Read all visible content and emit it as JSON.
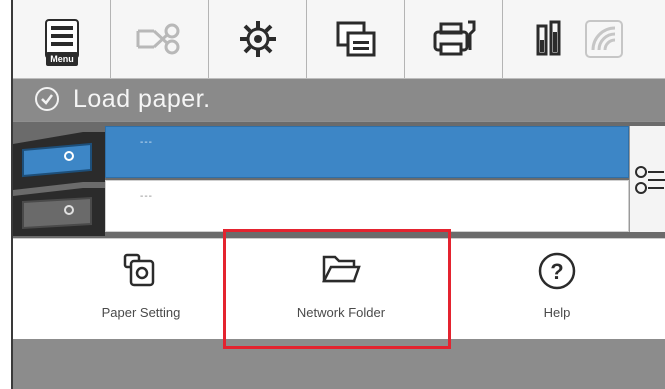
{
  "toolbar": {
    "menu_label": "Menu",
    "icons": [
      "menu-icon",
      "scissors-icon",
      "settings-gear-icon",
      "paper-stack-icon",
      "printer-maintenance-icon",
      "ink-cartridge-icon",
      "wifi-icon"
    ]
  },
  "status": {
    "message": "Load paper."
  },
  "paper_sources": [
    {
      "label": "---",
      "selected": true
    },
    {
      "label": "---",
      "selected": false
    }
  ],
  "buttons": {
    "paper_setting": "Paper Setting",
    "network_folder": "Network Folder",
    "help": "Help",
    "help_glyph": "?"
  },
  "colors": {
    "selection_blue": "#3d86c6",
    "highlight_red": "#e4232f",
    "status_gray": "#8a8a8a"
  }
}
